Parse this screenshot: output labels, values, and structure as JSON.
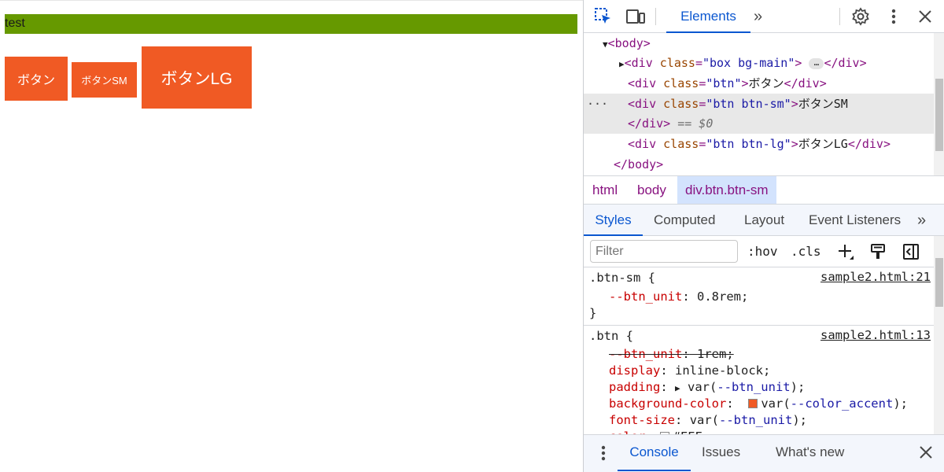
{
  "page": {
    "bar_text": "test",
    "buttons": {
      "main": "ボタン",
      "sm": "ボタンSM",
      "lg": "ボタンLG"
    },
    "colors": {
      "bar": "#669900",
      "accent": "#f05a24"
    }
  },
  "devtools": {
    "toolbar": {
      "elements_tab": "Elements",
      "more": "»",
      "icons": [
        "inspect-icon",
        "device-toggle-icon",
        "settings-icon",
        "kebab-menu-icon",
        "close-icon"
      ]
    },
    "dom": {
      "body_open": "<body>",
      "l1_tag_open": "<div ",
      "l1_attr": "class",
      "l1_val": "\"box bg-main\"",
      "l1_close": "</div>",
      "l1_ellipsis": "…",
      "l2_val": "\"btn\"",
      "l2_text": "ボタン",
      "l3_val": "\"btn btn-sm\"",
      "l3_text": "ボタンSM",
      "l3_eq": "== $0",
      "l4_val": "\"btn btn-lg\"",
      "l4_text": "ボタンLG",
      "body_close": "</body>",
      "div_open": "<div ",
      "div_close": "</div>",
      "gt": ">",
      "eq": "=",
      "dots": "···"
    },
    "breadcrumbs": [
      "html",
      "body",
      "div.btn.btn-sm"
    ],
    "subtabs": [
      "Styles",
      "Computed",
      "Layout",
      "Event Listeners"
    ],
    "subtabs_more": "»",
    "filter": {
      "placeholder": "Filter",
      "hov": ":hov",
      "cls": ".cls"
    },
    "rules": {
      "r1_selector": ".btn-sm {",
      "r1_source": "sample2.html:21",
      "r1_prop": "--btn_unit",
      "r1_value": "0.8rem;",
      "r2_selector": ".btn {",
      "r2_source": "sample2.html:13",
      "r2_p1": "--btn_unit",
      "r2_v1": "1rem;",
      "r2_p2": "display",
      "r2_v2": "inline-block;",
      "r2_p3": "padding",
      "r2_v3a": "var(",
      "r2_v3b": "--btn_unit",
      "r2_v3c": ");",
      "r2_p4": "background-color",
      "r2_v4a": "var(",
      "r2_v4b": "--color_accent",
      "r2_v4c": ");",
      "r2_p5": "font-size",
      "r2_v5a": "var(",
      "r2_v5b": "--btn_unit",
      "r2_v5c": ");",
      "r2_p6": "color",
      "r2_v6": "#FFF",
      "close_brace": "}",
      "colon": ":"
    },
    "drawer": {
      "tabs": [
        "Console",
        "Issues",
        "What's new"
      ]
    }
  }
}
